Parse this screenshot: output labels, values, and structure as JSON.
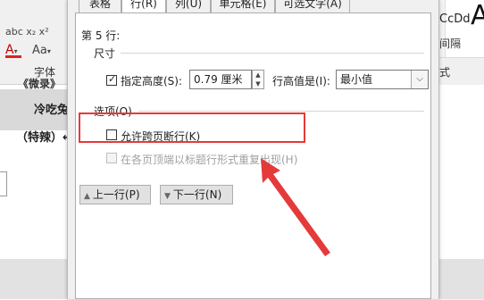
{
  "ribbon_left": {
    "font_row": "abc x₂ x²",
    "font_color_label": "A",
    "font_size_label": "Aa",
    "font_group_label": "字体",
    "doc_line1": "《微录》",
    "doc_line2": "冷吃兔",
    "doc_line3": "（特辣）↵"
  },
  "ribbon_right": {
    "style_preview": "CcDd",
    "big_letter": "A",
    "spacing_label": "间隔",
    "style_label": "式"
  },
  "dialog": {
    "tabs": [
      {
        "label": "表格(T)",
        "active": false
      },
      {
        "label": "行(R)",
        "active": true
      },
      {
        "label": "列(U)",
        "active": false
      },
      {
        "label": "单元格(E)",
        "active": false
      },
      {
        "label": "可选文字(A)",
        "active": false
      }
    ],
    "row_title": "第 5 行:",
    "size_group": "尺寸",
    "specify_height_label": "指定高度(S):",
    "specify_height_checked": true,
    "height_value": "0.79 厘米",
    "row_height_is_label": "行高值是(I):",
    "row_height_is_value": "最小值",
    "options_group": "选项(O)",
    "allow_break_label": "允许跨页断行(K)",
    "allow_break_checked": false,
    "repeat_header_label": "在各页顶端以标题行形式重复出现(H)",
    "repeat_header_checked": false,
    "prev_row_button": "上一行(P)",
    "next_row_button": "下一行(N)",
    "highlight_color": "#e53a3a"
  }
}
